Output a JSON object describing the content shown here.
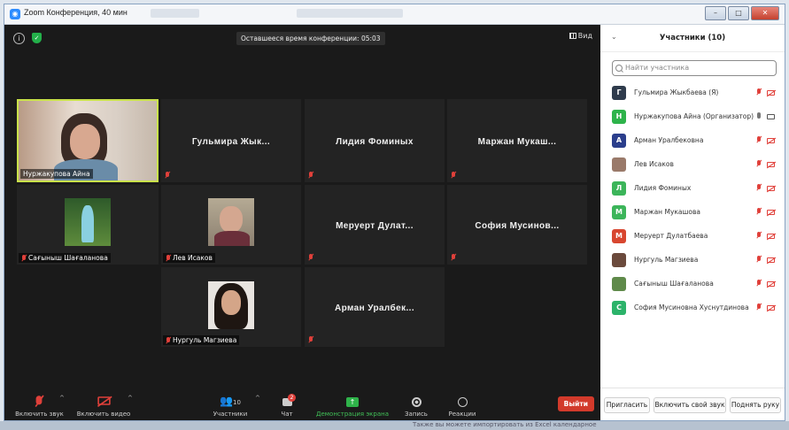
{
  "window": {
    "title": "Zoom Конференция, 40 мин"
  },
  "top": {
    "timer": "Оставшееся время конференции: 05:03",
    "view": "Вид"
  },
  "tiles": {
    "t1": "Нуржакупова Айна",
    "t2": "Гульмира Жык...",
    "t3": "Лидия Фоминых",
    "t4": "Маржан Мукаш...",
    "t5": "Сағыныш Шағаланова",
    "t6": "Лев Исаков",
    "t7": "Меруерт Дулат...",
    "t8": "София Мусинов...",
    "t9": "Нургуль Магзиева",
    "t10": "Арман Уралбек..."
  },
  "toolbar": {
    "mute": "Включить звук",
    "video": "Включить видео",
    "participants": "Участники",
    "participants_count": "10",
    "chat": "Чат",
    "chat_badge": "2",
    "share": "Демонстрация экрана",
    "record": "Запись",
    "reactions": "Реакции",
    "leave": "Выйти"
  },
  "panel": {
    "title": "Участники (10)",
    "search_placeholder": "Найти участника",
    "participants": [
      {
        "initial": "Г",
        "color": "#2f3b4c",
        "name": "Гульмира Жыкбаева (Я)"
      },
      {
        "initial": "Н",
        "color": "#2db34a",
        "name": "Нуржакупова Айна (Организатор)"
      },
      {
        "initial": "А",
        "color": "#2b3e8c",
        "name": "Арман Уралбековна"
      },
      {
        "initial": "",
        "color": "#9a7a6a",
        "name": "Лев Исаков"
      },
      {
        "initial": "Л",
        "color": "#3cb55a",
        "name": "Лидия Фоминых"
      },
      {
        "initial": "М",
        "color": "#3cb55a",
        "name": "Маржан Мукашова"
      },
      {
        "initial": "М",
        "color": "#d8462f",
        "name": "Меруерт Дулатбаева"
      },
      {
        "initial": "",
        "color": "#6b4a3c",
        "name": "Нургуль Магзиева"
      },
      {
        "initial": "",
        "color": "#5f8a4a",
        "name": "Сағыныш Шағаланова"
      },
      {
        "initial": "С",
        "color": "#2cb36a",
        "name": "София Мусиновна Хуснутдинова"
      }
    ],
    "invite": "Пригласить",
    "unmute_me": "Включить свой звук",
    "raise_hand": "Поднять руку"
  },
  "taskbar": {
    "text": "Также вы можете импортировать из Excel календарное"
  }
}
